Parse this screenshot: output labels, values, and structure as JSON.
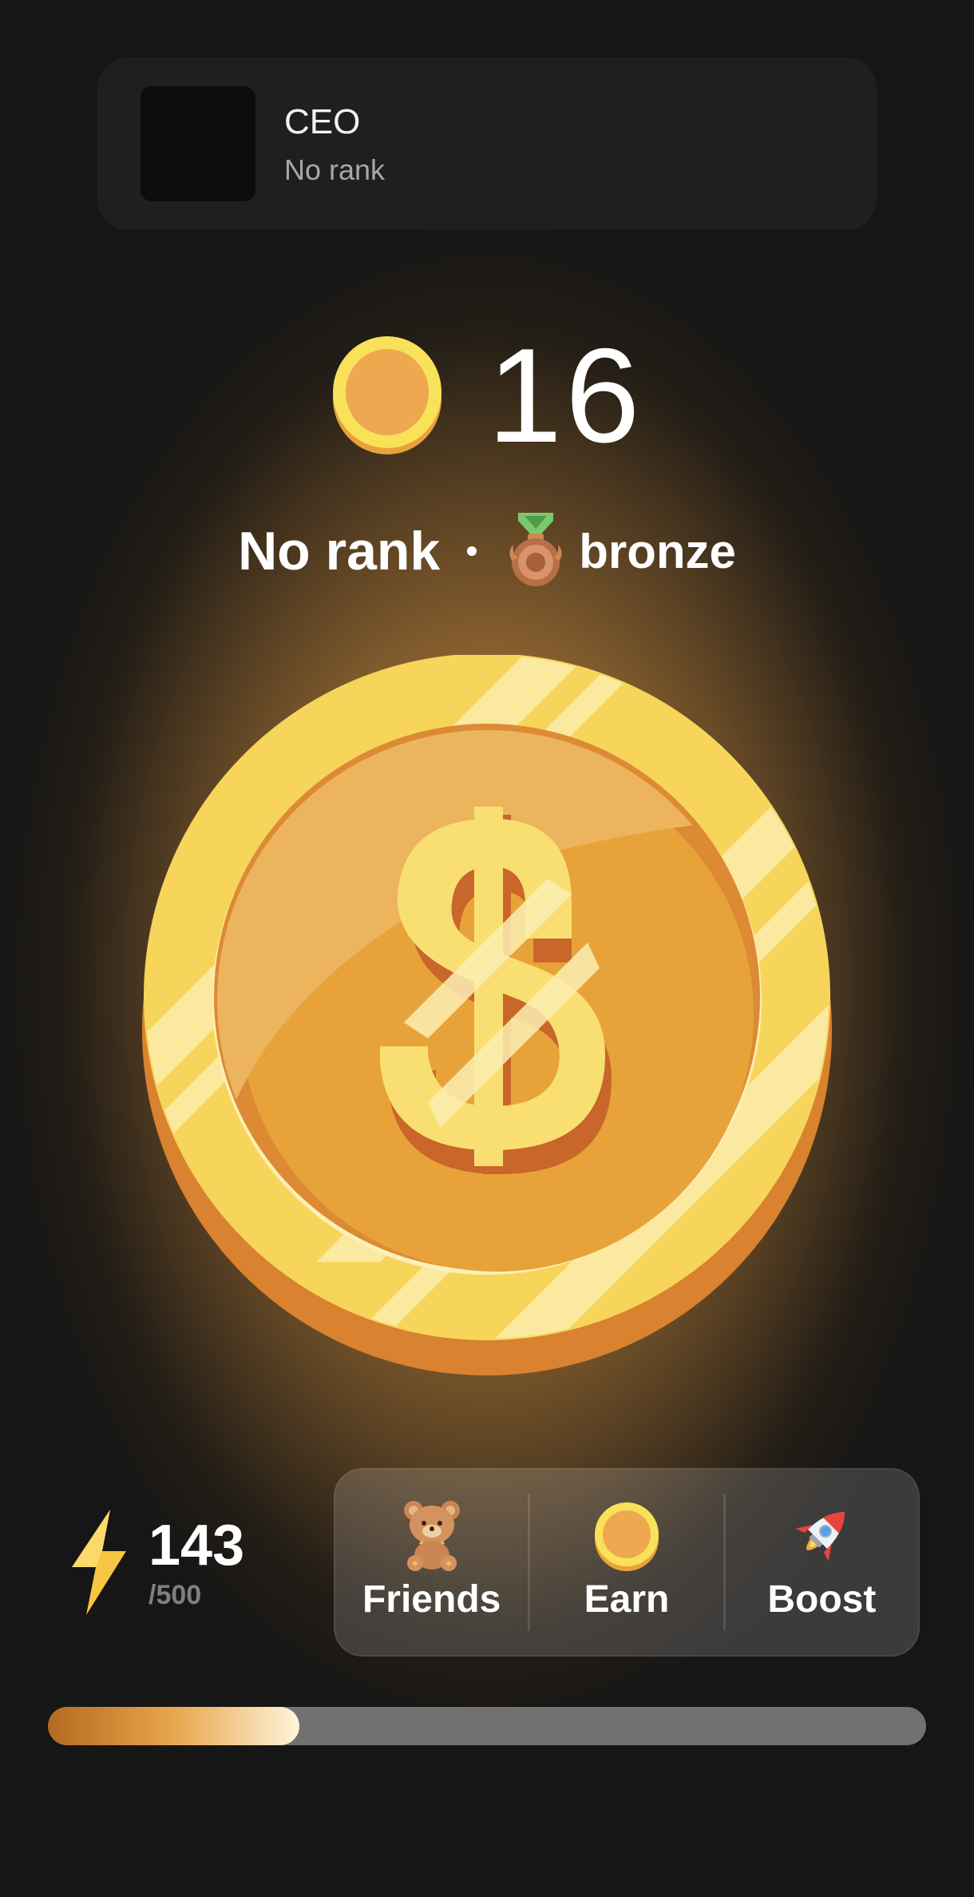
{
  "user": {
    "name": "CEO",
    "rank": "No rank"
  },
  "balance": {
    "value": "16",
    "icon": "coin-icon"
  },
  "rank_line": {
    "rank": "No rank",
    "league": "bronze",
    "icon": "bronze-medal-icon"
  },
  "main": {
    "tap_target_icon": "dollar-coin-icon"
  },
  "energy": {
    "current": "143",
    "max": "/500",
    "icon": "lightning-icon"
  },
  "nav": {
    "items": [
      {
        "label": "Friends",
        "icon": "teddy-bear-icon"
      },
      {
        "label": "Earn",
        "icon": "coin-icon"
      },
      {
        "label": "Boost",
        "icon": "rocket-icon"
      }
    ]
  },
  "progress": {
    "fraction": 0.286
  },
  "colors": {
    "background": "#161616",
    "coin_gold": "#f6d55a",
    "coin_orange": "#e8a23a",
    "accent_glow": "#c48b3d"
  }
}
